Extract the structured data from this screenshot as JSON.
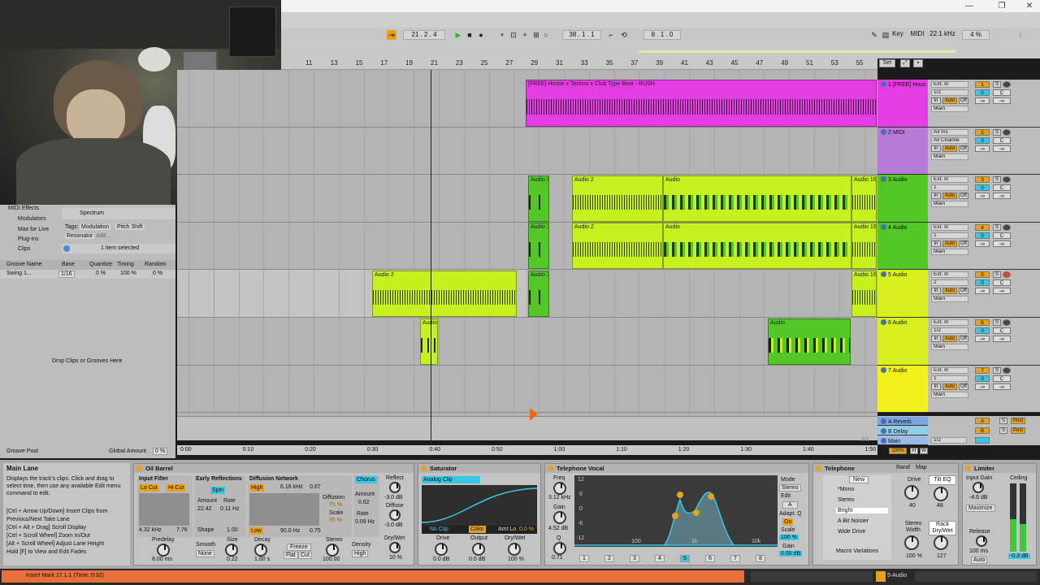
{
  "window": {
    "minimize": "—",
    "maximize": "❐",
    "close": "✕"
  },
  "transport": {
    "arrangement_pos": "21 . 2 . 4",
    "punch_pos": "38 . 1 . 1",
    "loop_len": "8 . 1 . 0",
    "key_label": "Key",
    "midi_label": "MIDI",
    "sample_rate": "22.1 kHz",
    "cpu": "4 %"
  },
  "ruler": {
    "bars": [
      "11",
      "13",
      "15",
      "17",
      "19",
      "21",
      "23",
      "25",
      "27",
      "29",
      "31",
      "33",
      "35",
      "37",
      "39",
      "41",
      "43",
      "45",
      "47",
      "49",
      "51",
      "53",
      "55"
    ],
    "set_label": "Set"
  },
  "timebar": {
    "ticks": [
      "0:00",
      "0:10",
      "0:20",
      "0:30",
      "0:40",
      "0:50",
      "1:00",
      "1:10",
      "1:20",
      "1:30",
      "1:40",
      "1:50"
    ],
    "page": "1/1"
  },
  "clips": {
    "track1": "[FREE] House x Techno x Club Type Beat - RUSH",
    "audio2": "Audio 2",
    "audio3": "Audio 3",
    "audio16": "Audio 16",
    "audio": "Audio"
  },
  "tracks": [
    {
      "name": "1 [FREE] Hous",
      "color": "#e33de3",
      "input": "Ext. In",
      "channel": "1/2",
      "num": "1",
      "vol": "0",
      "pan": "C"
    },
    {
      "name": "2 MIDI",
      "color": "#b67bd6",
      "input": "All Ins",
      "channel": "All Channe",
      "num": "2",
      "vol": "0",
      "pan": "C"
    },
    {
      "name": "3 Audio",
      "color": "#53c628",
      "input": "Ext. In",
      "channel": "1",
      "num": "3",
      "vol": "0",
      "pan": "C"
    },
    {
      "name": "4 Audio",
      "color": "#53c628",
      "input": "Ext. In",
      "channel": "1",
      "num": "4",
      "vol": "0",
      "pan": "C"
    },
    {
      "name": "5 Audio",
      "color": "#d7f01e",
      "input": "Ext. In",
      "channel": "2",
      "num": "5",
      "vol": "0",
      "pan": "C"
    },
    {
      "name": "6 Audio",
      "color": "#d7f01e",
      "input": "Ext. In",
      "channel": "1/2",
      "num": "6",
      "vol": "0",
      "pan": "C"
    },
    {
      "name": "7 Audio",
      "color": "#f3f01e",
      "input": "Ext. In",
      "channel": "1",
      "num": "7",
      "vol": "0",
      "pan": "C"
    }
  ],
  "io_common": {
    "monitor_in": "In",
    "monitor_auto": "Auto",
    "monitor_off": "Off",
    "out": "Main",
    "inf": "-∞",
    "solo": "S"
  },
  "returns": [
    {
      "name": "A Reverb",
      "letter": "A",
      "post": "Post"
    },
    {
      "name": "B Delay",
      "letter": "B",
      "post": "Post"
    },
    {
      "name": "Main",
      "letter": "",
      "post": "1/2"
    }
  ],
  "browser": {
    "categories": [
      "MIDI Effects",
      "Modulators",
      "Max for Live",
      "Plug-Ins",
      "Clips"
    ],
    "selected_item": "Spectrum",
    "tags_label": "Tags:",
    "tags": [
      "Modulation",
      "Pitch Shift",
      "Resonator",
      "Add..."
    ],
    "status": "1 item selected",
    "groove_headers": [
      "Groove Name",
      "Base",
      "Quantize",
      "Timing",
      "Random"
    ],
    "groove_row": [
      "Swing 1...",
      "1/16",
      "0 %",
      "100 %",
      "0 %"
    ],
    "drop_text": "Drop Clips or Grooves Here",
    "groove_pool": "Groove Pool",
    "global_amount_label": "Global Amount",
    "global_amount": "0 %"
  },
  "info_view": {
    "title": "Main Lane",
    "body": "Displays the track's clips. Click and drag to select time, then use any available Edit menu command to edit.",
    "shortcuts": "[Ctrl + Arrow Up/Down] Insert Clips from Previous/Next Take Lane\n[Ctrl + Alt + Drag] Scroll Display\n[Ctrl + Scroll Wheel] Zoom In/Out\n[Alt + Scroll Wheel] Adjust Lane Height\nHold [F] to View and Edit Fades"
  },
  "devices": {
    "oil_barrel": {
      "title": "Oil Barrel",
      "input_filter": "Input Filter",
      "lo_cut": "Lo Cut",
      "hi_cut": "Hi Cut",
      "freq": "4.32 kHz",
      "res": "7.76",
      "early": "Early Reflections",
      "spin": "Spin",
      "amount_label": "Amount",
      "amount": "22.42",
      "rate_label": "Rate",
      "rate": "0.11 Hz",
      "shape_label": "Shape",
      "shape": "1.00",
      "diffusion": "Diffusion Network",
      "high": "High",
      "high_freq": "6.16 kHz",
      "high_val": "0.67",
      "low": "Low",
      "low_freq": "90.0 Hz",
      "low_val": "0.75",
      "diff_label": "Diffusion",
      "diff_val": "75 %",
      "scale_label": "Scale",
      "scale_val": "35 %",
      "chorus": "Chorus",
      "ch_amount_label": "Amount",
      "ch_amount": "0.62",
      "ch_rate_label": "Rate",
      "ch_rate": "0.09 Hz",
      "predelay_label": "Predelay",
      "predelay": "8.00 ms",
      "smooth_label": "Smooth",
      "smooth": "None",
      "size_label": "Size",
      "size": "0.22",
      "decay_label": "Decay",
      "decay": "1.60 s",
      "freeze": "Freeze",
      "flat": "Flat",
      "cut": "Cut",
      "stereo_label": "Stereo",
      "stereo": "100.00",
      "density_label": "Density",
      "density": "High",
      "reflect_label": "Reflect",
      "reflect": "-3.0 dB",
      "diffuse_label": "Diffuse",
      "diffuse": "-3.0 dB",
      "drywet_label": "Dry/Wet",
      "drywet": "10 %"
    },
    "saturator": {
      "title": "Saturator",
      "mode": "Analog Clip",
      "noclip": "No Clip",
      "color": "Color",
      "amt_lo_label": "Amt Lo",
      "amt_lo": "0.0 %",
      "drive_label": "Drive",
      "drive": "0.0 dB",
      "output_label": "Output",
      "output": "0.0 dB",
      "drywet_label": "Dry/Wet",
      "drywet": "100 %"
    },
    "telephone_vocal": {
      "title": "Telephone Vocal",
      "freq_label": "Freq",
      "freq": "3.12 kHz",
      "gain_label": "Gain",
      "gain": "4.52 dB",
      "q_label": "Q",
      "q": "0.71",
      "db_ticks": [
        "12",
        "6",
        "0",
        "-6",
        "-12"
      ],
      "hz_ticks": [
        "100",
        "1k",
        "10k"
      ],
      "mode_label": "Mode",
      "mode": "Stereo",
      "edit_label": "Edit",
      "edit": "A",
      "adapt_label": "Adapt. Q",
      "adapt": "On",
      "scale_label": "Scale",
      "scale": "100 %",
      "outgain_label": "Gain",
      "outgain": "0.00 dB",
      "bands": [
        "1",
        "2",
        "3",
        "4",
        "5",
        "6",
        "7",
        "8"
      ]
    },
    "telephone": {
      "title": "Telephone",
      "new_btn": "New",
      "rand": "Rand",
      "map": "Map",
      "variations": [
        "*Mono",
        "Stereo",
        "Bright",
        "A Bit Noisier",
        "Wide Drive"
      ],
      "macro": "Macro Variations",
      "tilt": "Tilt EQ",
      "drive_label": "Drive",
      "drive": "40",
      "tilt_val": "48",
      "sw_label": "Stereo Width",
      "sw": "100 %",
      "rack_label": "Rack Dry/Wet",
      "rack": "127"
    },
    "limiter": {
      "title": "Limiter",
      "input_gain_label": "Input Gain",
      "input_gain": "-4.6 dB",
      "maximize": "Maximize",
      "release_label": "Release",
      "release": "100 ms",
      "auto": "Auto",
      "ceiling_label": "Ceiling",
      "ceiling": "-0.3 dB"
    }
  },
  "status": {
    "message": "Insert Mark 17.1.1 (Time: 0:32)",
    "track": "5-Audio"
  },
  "colors": {
    "pink": "#e33de3",
    "lime": "#c6f01e",
    "green": "#53c628",
    "orange": "#e6a21a",
    "status_bar": "#e8703a"
  }
}
